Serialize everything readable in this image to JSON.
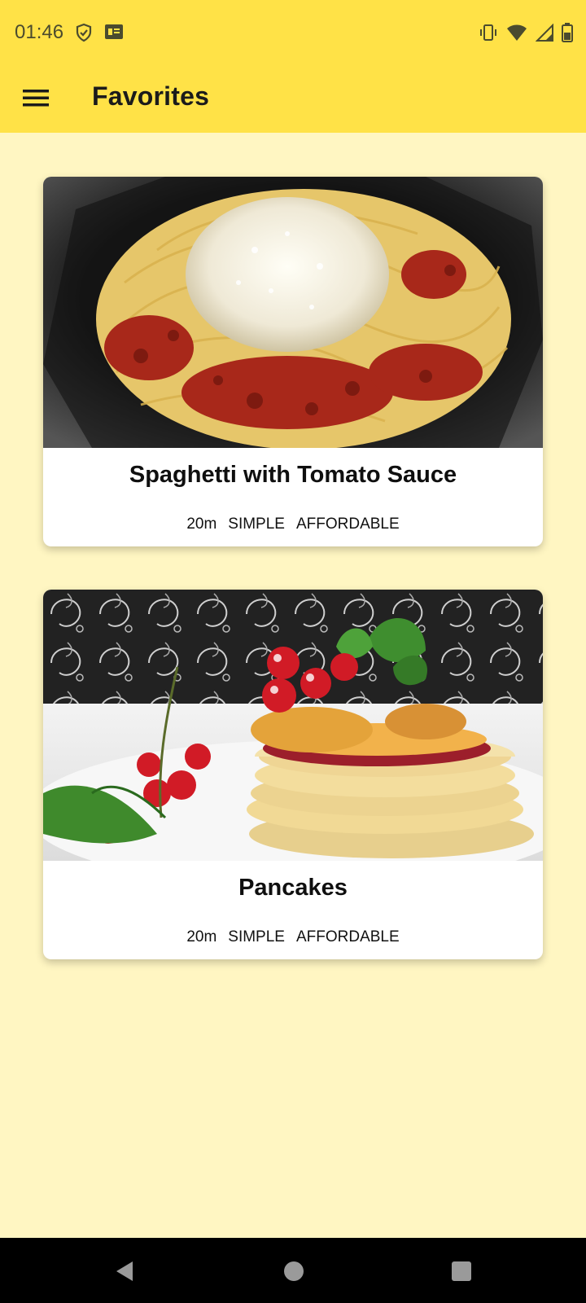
{
  "status_bar": {
    "time": "01:46",
    "left_icons": [
      "shield-check-icon",
      "news-badge-icon"
    ],
    "right_icons": [
      "vibrate-icon",
      "wifi-icon",
      "signal-icon",
      "battery-icon"
    ]
  },
  "app_bar": {
    "title": "Favorites",
    "menu_icon": "hamburger-menu-icon",
    "background": "#ffe247"
  },
  "page": {
    "background": "#fff6c2"
  },
  "meals": [
    {
      "title": "Spaghetti with Tomato Sauce",
      "duration": "20m",
      "complexity": "SIMPLE",
      "affordability": "AFFORDABLE",
      "image": "spaghetti-photo"
    },
    {
      "title": "Pancakes",
      "duration": "20m",
      "complexity": "SIMPLE",
      "affordability": "AFFORDABLE",
      "image": "pancakes-photo"
    }
  ],
  "nav_bar": {
    "buttons": [
      "back-icon",
      "home-icon",
      "recents-icon"
    ]
  }
}
